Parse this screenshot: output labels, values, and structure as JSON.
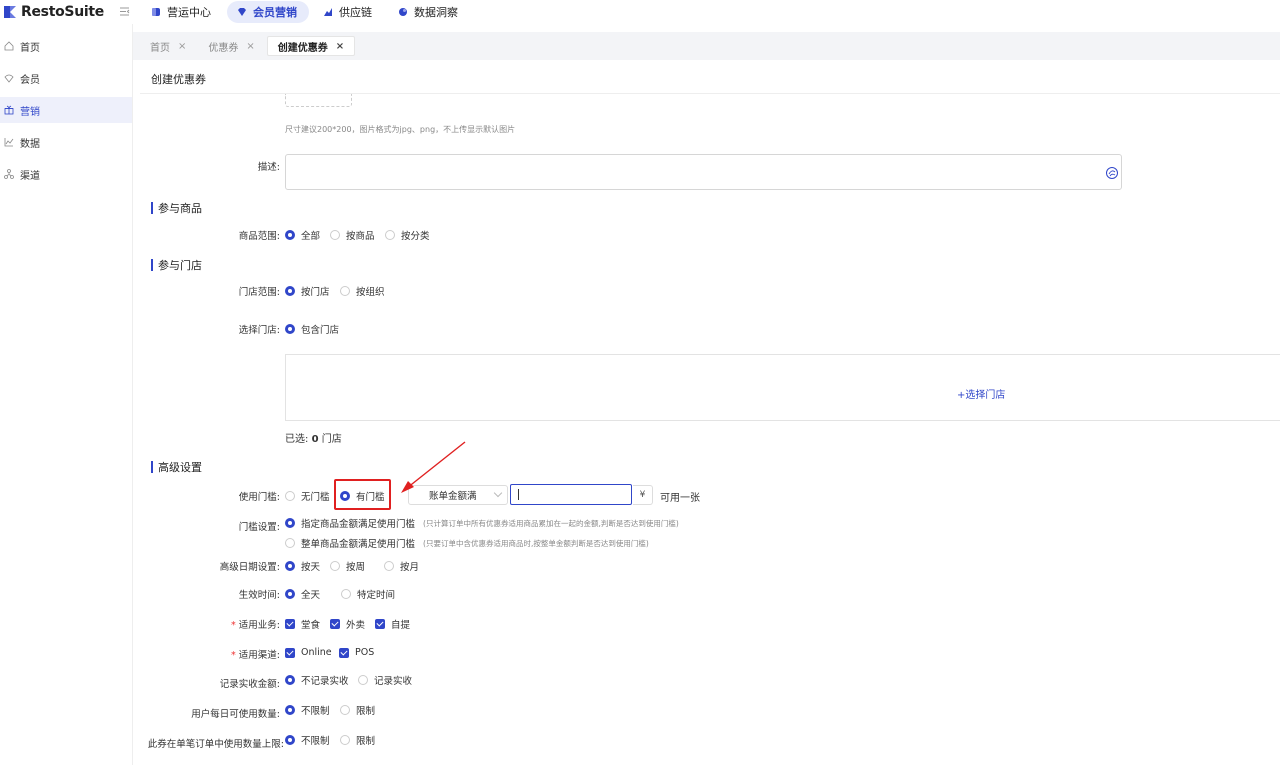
{
  "brand": {
    "name": "RestoSuite"
  },
  "nav": [
    {
      "label": "营运中心",
      "icon": "store-icon"
    },
    {
      "label": "会员营销",
      "icon": "crown-icon",
      "active": true
    },
    {
      "label": "供应链",
      "icon": "chart-icon"
    },
    {
      "label": "数据洞察",
      "icon": "insight-icon"
    }
  ],
  "sidebar": [
    {
      "label": "首页",
      "icon": "home-icon"
    },
    {
      "label": "会员",
      "icon": "member-icon"
    },
    {
      "label": "营销",
      "icon": "gift-icon",
      "active": true
    },
    {
      "label": "数据",
      "icon": "trend-icon"
    },
    {
      "label": "渠道",
      "icon": "channel-icon"
    }
  ],
  "tabs": [
    {
      "label": "首页",
      "close": "×"
    },
    {
      "label": "优惠券",
      "close": "×"
    },
    {
      "label": "创建优惠券",
      "close": "×",
      "active": true
    }
  ],
  "page": {
    "title": "创建优惠券"
  },
  "image": {
    "hint": "尺寸建议200*200，图片格式为jpg、png，不上传显示默认图片"
  },
  "description": {
    "label": "描述:"
  },
  "goods": {
    "section": "参与商品",
    "range_label": "商品范围:",
    "options": [
      "全部",
      "按商品",
      "按分类"
    ],
    "selected": "全部"
  },
  "stores": {
    "section": "参与门店",
    "range_label": "门店范围:",
    "range_options": [
      "按门店",
      "按组织"
    ],
    "select_label": "选择门店:",
    "select_option": "包含门店",
    "add_link": "+选择门店",
    "selected_prefix": "已选:",
    "selected_count": "0",
    "selected_suffix": "门店"
  },
  "advanced": {
    "section": "高级设置",
    "threshold_label": "使用门槛:",
    "threshold_options": [
      "无门槛",
      "有门槛"
    ],
    "threshold_selected": "有门槛",
    "threshold_select": "账单金额满",
    "currency": "¥",
    "usable_suffix": "可用一张",
    "threshold_setting_label": "门槛设置:",
    "threshold_setting_1": "指定商品金额满足使用门槛",
    "threshold_setting_1_note": "(只计算订单中所有优惠券适用商品累加在一起的金额,判断是否达到使用门槛)",
    "threshold_setting_2": "整单商品金额满足使用门槛",
    "threshold_setting_2_note": "(只要订单中含优惠券适用商品时,按整单金额判断是否达到使用门槛)",
    "date_label": "高级日期设置:",
    "date_options": [
      "按天",
      "按周",
      "按月"
    ],
    "time_label": "生效时间:",
    "time_options": [
      "全天",
      "特定时间"
    ],
    "business_label": "适用业务:",
    "business_options": [
      "堂食",
      "外卖",
      "自提"
    ],
    "channel_label": "适用渠道:",
    "channel_options": [
      "Online",
      "POS"
    ],
    "record_label": "记录实收金额:",
    "record_options": [
      "不记录实收",
      "记录实收"
    ],
    "daily_label": "用户每日可使用数量:",
    "daily_options": [
      "不限制",
      "限制"
    ],
    "per_order_label": "此券在单笔订单中使用数量上限:",
    "per_order_options": [
      "不限制",
      "限制"
    ]
  },
  "colors": {
    "primary": "#3046c9",
    "highlight": "#e02020"
  }
}
